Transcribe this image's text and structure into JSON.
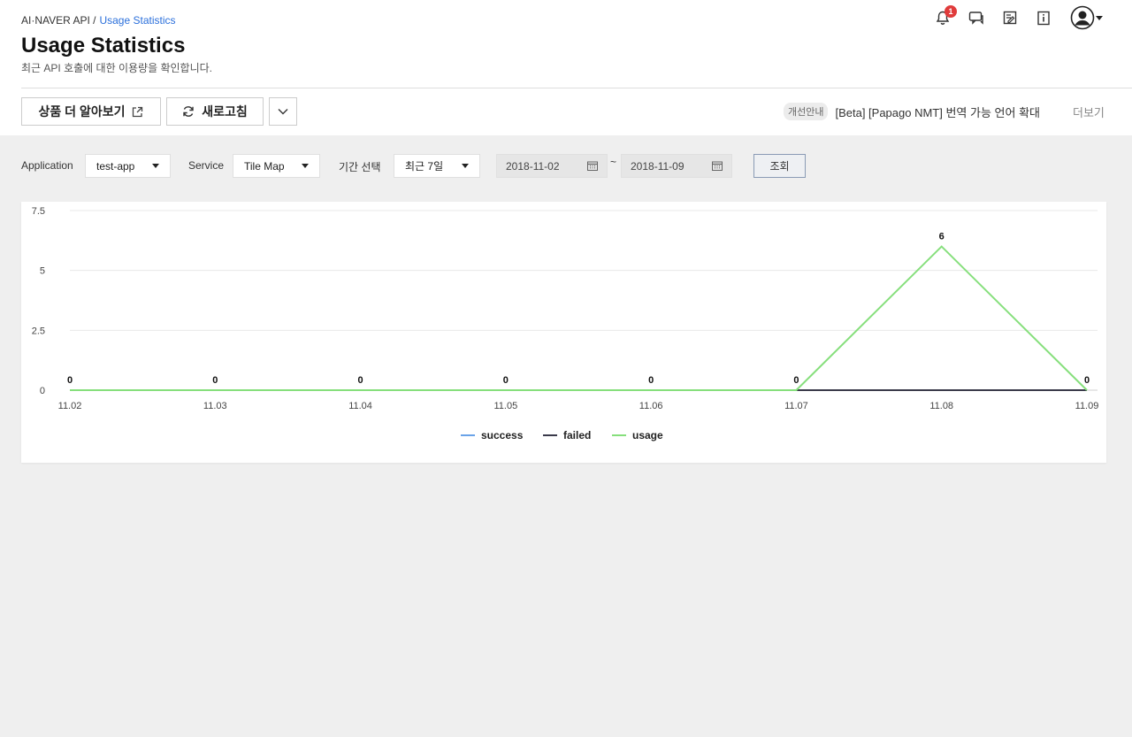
{
  "breadcrumb": {
    "parent": "AI·NAVER API /",
    "current": "Usage Statistics"
  },
  "header": {
    "title": "Usage Statistics",
    "description": "최근 API 호출에 대한 이용량을 확인합니다.",
    "notification_count": "1"
  },
  "toolbar": {
    "learn_more_label": "상품 더 알아보기",
    "refresh_label": "새로고침"
  },
  "notice": {
    "tag": "개선안내",
    "text": "[Beta] [Papago NMT] 번역 가능 언어 확대",
    "more_label": "더보기"
  },
  "filters": {
    "application_label": "Application",
    "application_value": "test-app",
    "service_label": "Service",
    "service_value": "Tile Map",
    "period_label": "기간 선택",
    "period_value": "최근 7일",
    "start_date": "2018-11-02",
    "separator": "~",
    "end_date": "2018-11-09",
    "query_label": "조회"
  },
  "chart_data": {
    "type": "line",
    "x": [
      "11.02",
      "11.03",
      "11.04",
      "11.05",
      "11.06",
      "11.07",
      "11.08",
      "11.09"
    ],
    "ylim": [
      0,
      7.5
    ],
    "yticks": [
      0,
      2.5,
      5,
      7.5
    ],
    "ytick_labels": [
      "0",
      "2.5",
      "5",
      "7.5"
    ],
    "grid": true,
    "legend_position": "bottom",
    "series": [
      {
        "name": "success",
        "color": "#6aa3e8",
        "values": [
          0,
          0,
          0,
          0,
          0,
          0,
          0,
          0
        ]
      },
      {
        "name": "failed",
        "color": "#3a3a4a",
        "values": [
          0,
          0,
          0,
          0,
          0,
          0,
          0,
          0
        ]
      },
      {
        "name": "usage",
        "color": "#86df7c",
        "values": [
          0,
          0,
          0,
          0,
          0,
          0,
          6,
          0
        ]
      }
    ],
    "data_labels": [
      "0",
      "0",
      "0",
      "0",
      "0",
      "0",
      "6",
      "0"
    ]
  }
}
